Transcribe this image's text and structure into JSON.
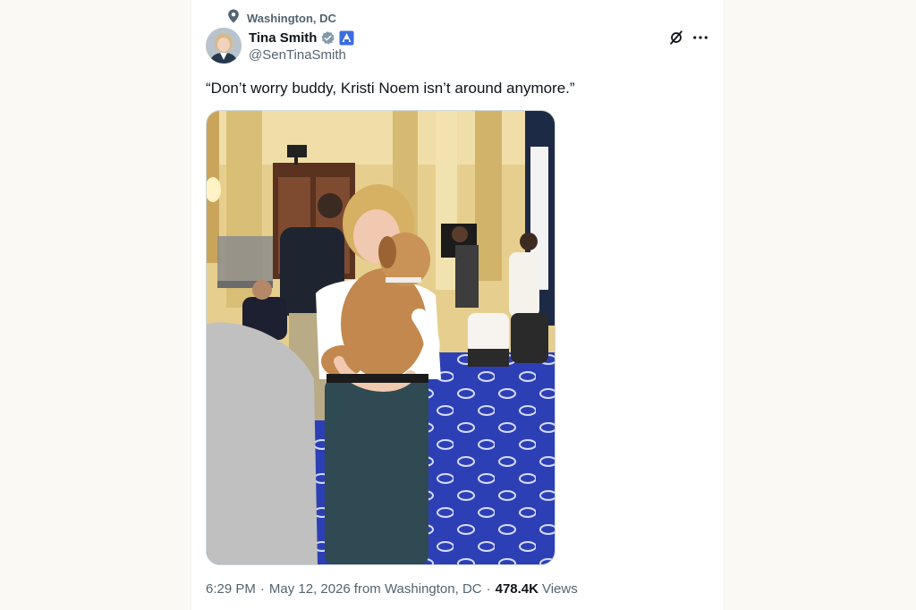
{
  "tweet": {
    "location": "Washington, DC",
    "author": {
      "display_name": "Tina Smith",
      "handle": "@SenTinaSmith",
      "verified_color": "#829aab",
      "affiliate_color": "#3b6de0"
    },
    "text": "“Don’t worry buddy, Kristi Noem isn’t around anymore.”",
    "meta": {
      "time": "6:29 PM",
      "dot1": "·",
      "date": "May 12, 2026",
      "source": "from Washington, DC",
      "dot2": "·",
      "views_count": "478.4K",
      "views_label": "Views"
    },
    "icons": {
      "location": "location-pin-icon",
      "grok": "grok-icon",
      "more": "more-horizontal-icon"
    }
  }
}
